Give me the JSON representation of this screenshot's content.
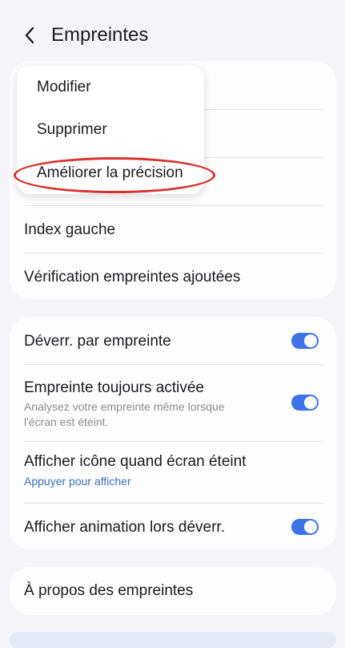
{
  "header": {
    "title": "Empreintes",
    "back_icon": "chevron-left-icon"
  },
  "fingerprints_card": {
    "items": [
      {
        "label": "Index gauche"
      },
      {
        "label": "Vérification empreintes ajoutées"
      }
    ]
  },
  "context_menu": {
    "items": [
      {
        "label": "Modifier"
      },
      {
        "label": "Supprimer"
      },
      {
        "label": "Améliorer la précision"
      }
    ]
  },
  "settings_card": {
    "unlock": {
      "label": "Déverr. par empreinte",
      "enabled": true
    },
    "always_on": {
      "label": "Empreinte toujours activée",
      "description_line1": "Analysez votre empreinte même lorsque",
      "description_line2": "l'écran est éteint.",
      "enabled": true
    },
    "show_icon": {
      "label": "Afficher icône quand écran éteint",
      "link": "Appuyer pour afficher"
    },
    "animation": {
      "label": "Afficher animation lors déverr.",
      "enabled": true
    }
  },
  "about": {
    "label": "À propos des empreintes"
  },
  "colors": {
    "accent": "#3e74e8",
    "link": "#3b6fb2",
    "annotation": "#d9302c",
    "background": "#f5f4f9"
  }
}
